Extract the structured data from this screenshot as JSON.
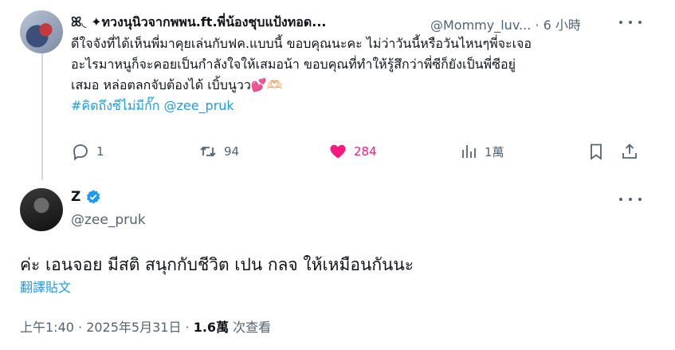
{
  "original_post": {
    "display_name": "ꕤ◟ ✦ทวงนุนิวจากพพน.ft.พี่น้องชุบแป้งทอด...",
    "handle": "@Mommy_luv...",
    "separator": "·",
    "time_ago": "6 小時",
    "body_lines": [
      "ดีใจจังที่ได้เห็นพี่มาคุยเล่นกับฟค.แบบนี้ ขอบคุณนะคะ ไม่ว่าวันนี้หรือวันไหนๆพี่จะเจอ",
      "อะไรมาหนูก็จะคอยเป็นกำลังใจให้เสมอน้า ขอบคุณที่ทำให้รู้สึกว่าพี่ซีก็ยังเป็นพี่ซีอยู่",
      "เสมอ หล่อตลกจับต้องได้ เบิ้บนูวว"
    ],
    "body_emojis": "💕🫶🏻",
    "hashtags": "#คิดถึงซีไม่มีกั๊ก @zee_pruk",
    "stats": {
      "replies": "1",
      "reposts": "94",
      "likes": "284",
      "views": "1萬"
    }
  },
  "reply_post": {
    "display_name": "Z",
    "handle": "@zee_pruk",
    "text": "ค่ะ เอนจอย มีสติ สนุกกับชีวิต เปน กลจ ให้เหมือนกันนะ",
    "translate_label": "翻譯貼文",
    "timestamp": "上午1:40 · 2025年5月31日 · ",
    "views_count": "1.6萬",
    "views_label": " 次查看"
  },
  "colors": {
    "accent": "#1d9bf0",
    "like": "#f91880",
    "muted": "#536471",
    "text": "#0f1419"
  }
}
